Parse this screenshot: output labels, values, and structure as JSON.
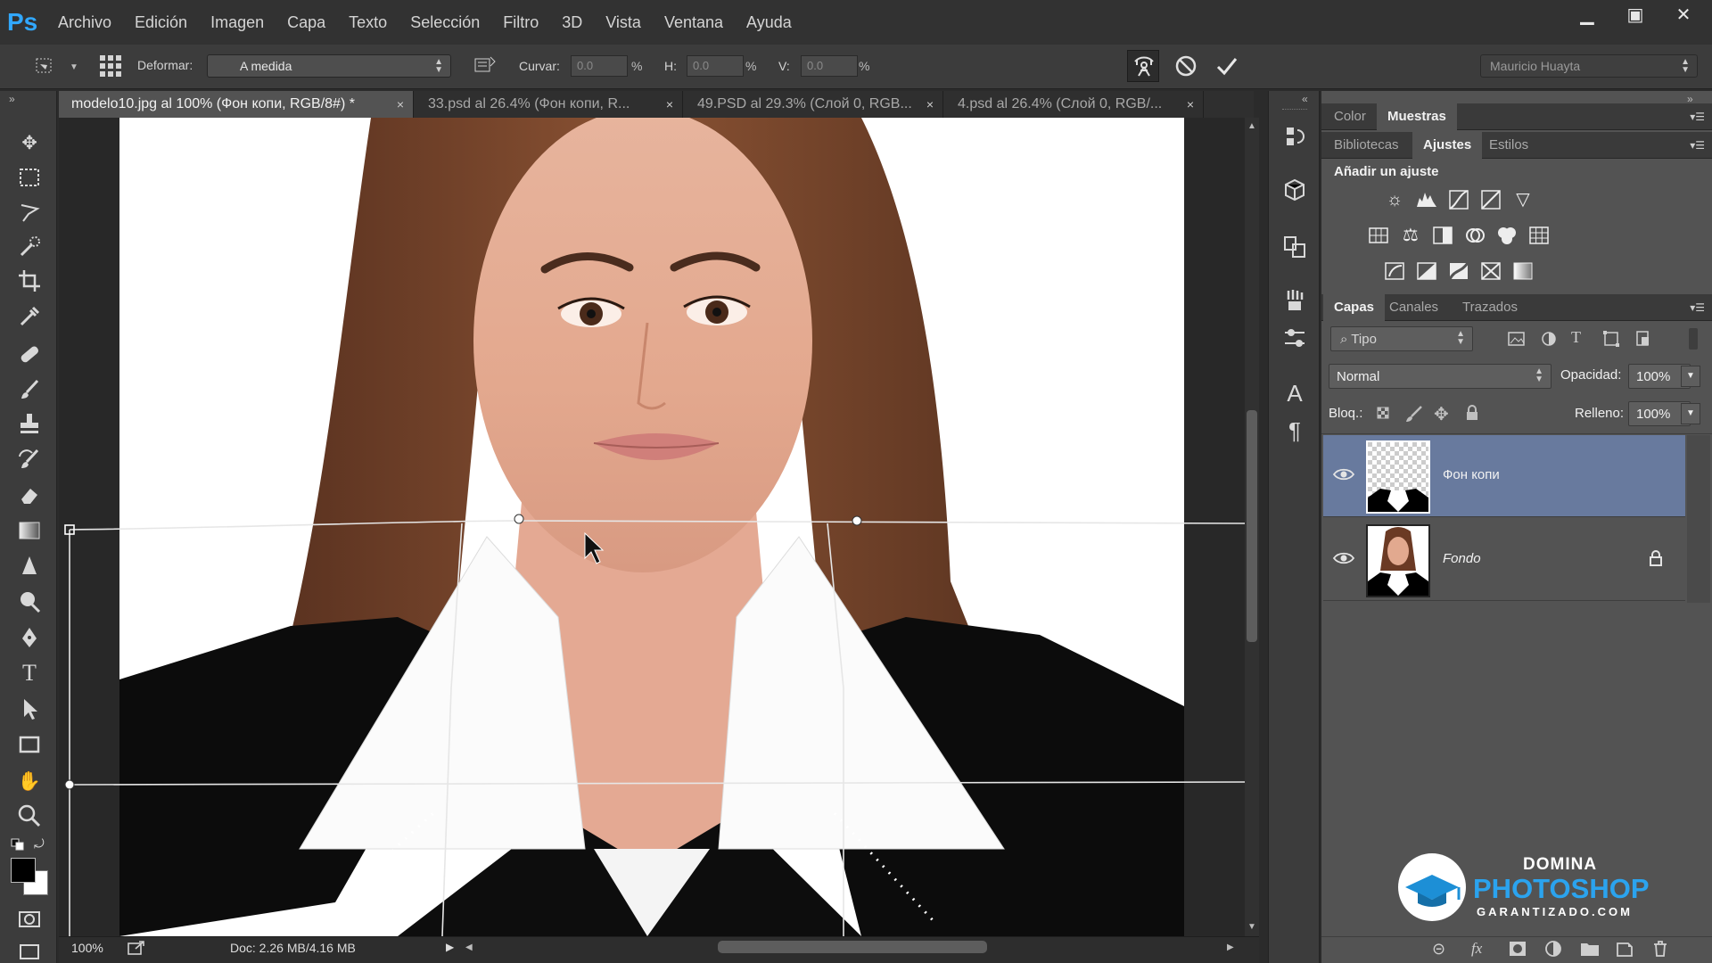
{
  "app": {
    "logo_text": "Ps"
  },
  "menu": [
    "Archivo",
    "Edición",
    "Imagen",
    "Capa",
    "Texto",
    "Selección",
    "Filtro",
    "3D",
    "Vista",
    "Ventana",
    "Ayuda"
  ],
  "options": {
    "warp_label": "Deformar:",
    "warp_value": "A medida",
    "bend_label": "Curvar:",
    "bend_value": "0.0",
    "h_label": "H:",
    "h_value": "0.0",
    "v_label": "V:",
    "v_value": "0.0",
    "percent": "%",
    "workspace": "Mauricio Huayta"
  },
  "tabs": [
    {
      "label": "modelo10.jpg al 100% (Фон копи, RGB/8#) *",
      "active": true
    },
    {
      "label": "33.psd al 26.4% (Фон копи, R...",
      "active": false
    },
    {
      "label": "49.PSD al 29.3% (Слой 0, RGB...",
      "active": false
    },
    {
      "label": "4.psd al 26.4% (Слой 0, RGB/...",
      "active": false
    }
  ],
  "tab_close": "×",
  "status": {
    "zoom": "100%",
    "doc": "Doc: 2.26 MB/4.16 MB"
  },
  "panels": {
    "color_tabs": [
      "Color",
      "Muestras"
    ],
    "adjust_tabs": [
      "Bibliotecas",
      "Ajustes",
      "Estilos"
    ],
    "adjust_title": "Añadir un ajuste",
    "layer_tabs": [
      "Capas",
      "Canales",
      "Trazados"
    ],
    "filter_placeholder": "Tipo",
    "blend_mode": "Normal",
    "opacity_label": "Opacidad:",
    "opacity_value": "100%",
    "lock_label": "Bloq.:",
    "fill_label": "Relleno:",
    "fill_value": "100%"
  },
  "layers": [
    {
      "name": "Фон копи",
      "selected": true,
      "locked": false
    },
    {
      "name": "Fondo",
      "selected": false,
      "locked": true
    }
  ],
  "watermark": {
    "line1": "DOMINA",
    "line2": "PHOTOSHOP",
    "line3": "GARANTIZADO.COM"
  },
  "colors": {
    "accent": "#31a8ff",
    "selected_layer": "#687a9e",
    "panel_bg": "#535353",
    "app_bg": "#323232"
  }
}
